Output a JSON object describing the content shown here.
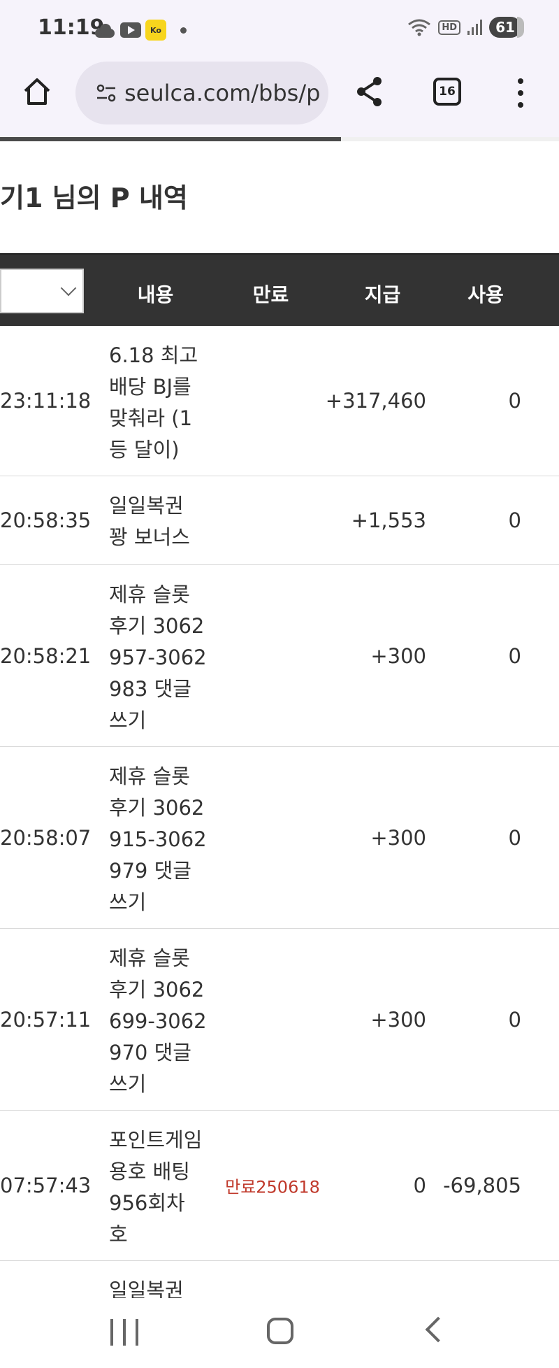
{
  "status": {
    "time": "11:19",
    "battery": "61",
    "hd": "HD",
    "kakao": "Ko"
  },
  "browser": {
    "url": "seulca.com/bbs/p",
    "tab_count": "16",
    "progress": 0.61
  },
  "page": {
    "title": "기1 님의 P 내역"
  },
  "table": {
    "headers": {
      "content": "내용",
      "expire": "만료",
      "pay": "지급",
      "use": "사용"
    },
    "rows": [
      {
        "time": "23:11:18",
        "content": "6.18 최고 배당 BJ를 맞춰라 (1등 달이)",
        "expire": "",
        "pay": "+317,460",
        "use": "0"
      },
      {
        "time": "20:58:35",
        "content": "일일복권 꽝 보너스",
        "expire": "",
        "pay": "+1,553",
        "use": "0"
      },
      {
        "time": "20:58:21",
        "content": "제휴 슬롯 후기 3062957-3062983 댓글쓰기",
        "expire": "",
        "pay": "+300",
        "use": "0"
      },
      {
        "time": "20:58:07",
        "content": "제휴 슬롯 후기 3062915-3062979 댓글쓰기",
        "expire": "",
        "pay": "+300",
        "use": "0"
      },
      {
        "time": "20:57:11",
        "content": "제휴 슬롯 후기 3062699-3062970 댓글쓰기",
        "expire": "",
        "pay": "+300",
        "use": "0"
      },
      {
        "time": "07:57:43",
        "content": "포인트게임 용호 배팅 956회차 호",
        "expire": "만료250618",
        "pay": "0",
        "use": "-69,805"
      },
      {
        "time": "",
        "content": "일일복권",
        "expire": "",
        "pay": "",
        "use": ""
      }
    ]
  }
}
